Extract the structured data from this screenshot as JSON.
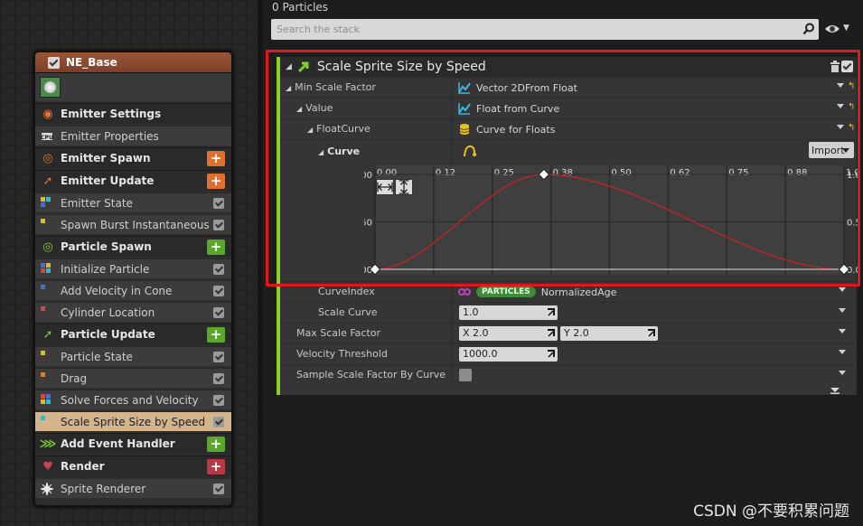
{
  "node": {
    "title": "NE_Base",
    "header_color": "#8c4a30",
    "items": [
      {
        "kind": "group",
        "label": "Emitter Settings",
        "icon": "emitter-settings-icon",
        "icon_color": "#e6703a",
        "plus": false
      },
      {
        "kind": "sub",
        "label": "Emitter Properties",
        "icon": "cpu-icon"
      },
      {
        "kind": "group",
        "label": "Emitter Spawn",
        "icon": "emitter-spawn-icon",
        "icon_color": "#e67030",
        "plus": true,
        "plus_color": "#e07030"
      },
      {
        "kind": "group",
        "label": "Emitter Update",
        "icon": "emitter-update-icon",
        "icon_color": "#e67030",
        "plus": true,
        "plus_color": "#e07030"
      },
      {
        "kind": "sub",
        "label": "Emitter State",
        "icon": "module-dots-icon",
        "dots": [
          "#d8c020",
          "#20c0d0",
          "#4a6ae0"
        ]
      },
      {
        "kind": "sub",
        "label": "Spawn Burst Instantaneous",
        "icon": "module-dots-icon",
        "dots": [
          "#d8c020"
        ]
      },
      {
        "kind": "group",
        "label": "Particle Spawn",
        "icon": "particle-spawn-icon",
        "icon_color": "#7ccf2e",
        "plus": true,
        "plus_color": "#5aa82a"
      },
      {
        "kind": "sub",
        "label": "Initialize Particle",
        "icon": "module-dots-icon",
        "dots": [
          "#4a6ae0",
          "#d8c020",
          "#e04040",
          "#20c0d0"
        ]
      },
      {
        "kind": "sub",
        "label": "Add Velocity in Cone",
        "icon": "module-dots-icon",
        "dots": [
          "#4a6ae0"
        ]
      },
      {
        "kind": "sub",
        "label": "Cylinder Location",
        "icon": "module-dots-icon",
        "dots": [
          "#e04040"
        ]
      },
      {
        "kind": "group",
        "label": "Particle Update",
        "icon": "particle-update-icon",
        "icon_color": "#7ccf2e",
        "plus": true,
        "plus_color": "#5aa82a"
      },
      {
        "kind": "sub",
        "label": "Particle State",
        "icon": "module-dots-icon",
        "dots": [
          "#d8c020"
        ]
      },
      {
        "kind": "sub",
        "label": "Drag",
        "icon": "module-dots-icon",
        "dots": [
          "#e08020"
        ]
      },
      {
        "kind": "sub",
        "label": "Solve Forces and Velocity",
        "icon": "module-dots-icon",
        "dots": [
          "#e04040",
          "#4a6ae0",
          "#d8c020",
          "#20c0d0"
        ]
      },
      {
        "kind": "sub",
        "label": "Scale Sprite Size by Speed",
        "icon": "module-dots-icon",
        "dots": [
          "#20c0d0"
        ],
        "selected": true
      },
      {
        "kind": "group",
        "label": "Add Event Handler",
        "icon": "event-handler-icon",
        "icon_color": "#7ccf2e",
        "plus": true,
        "plus_color": "#5aa82a"
      },
      {
        "kind": "group",
        "label": "Render",
        "icon": "render-icon",
        "icon_color": "#d04050",
        "plus": true,
        "plus_color": "#b83a48"
      },
      {
        "kind": "sub",
        "label": "Sprite Renderer",
        "icon": "sprite-renderer-icon"
      }
    ]
  },
  "stack": {
    "particle_count": "0 Particles",
    "search_placeholder": "Search the stack"
  },
  "module": {
    "title": "Scale Sprite Size by Speed",
    "accent_color": "#8bd12a",
    "rows": {
      "min_scale_factor": {
        "label": "Min Scale Factor",
        "value": "Vector 2DFrom Float"
      },
      "value": {
        "label": "Value",
        "value": "Float from Curve"
      },
      "float_curve": {
        "label": "FloatCurve",
        "value": "Curve for Floats"
      },
      "curve": {
        "label": "Curve",
        "button": "Import"
      },
      "curve_index": {
        "label": "CurveIndex",
        "pill": "PARTICLES",
        "value": "NormalizedAge"
      },
      "scale_curve": {
        "label": "Scale Curve",
        "value": "1.0"
      },
      "max_scale_factor": {
        "label": "Max Scale Factor",
        "x": "X 2.0",
        "y": "Y 2.0"
      },
      "velocity_threshold": {
        "label": "Velocity Threshold",
        "value": "1000.0"
      },
      "sample_scale": {
        "label": "Sample Scale Factor By Curve"
      }
    }
  },
  "chart_data": {
    "type": "line",
    "x_ticks": [
      "0.00",
      "0.12",
      "0.25",
      "0.38",
      "0.50",
      "0.62",
      "0.75",
      "0.88",
      "1.00"
    ],
    "y_ticks_left": [
      "1.00",
      "0.50",
      "0.00"
    ],
    "y_ticks_right": [
      "1.00",
      "0.50",
      "0.00"
    ],
    "xlim": [
      0,
      1
    ],
    "ylim": [
      0,
      1
    ],
    "grid": true,
    "series": [
      {
        "x": [
          0,
          0.36,
          1
        ],
        "y": [
          0,
          1,
          0
        ],
        "color": "#d02020"
      }
    ],
    "keys": [
      {
        "x": 0,
        "y": 0
      },
      {
        "x": 0.36,
        "y": 1
      },
      {
        "x": 1,
        "y": 0
      }
    ]
  },
  "watermark": "CSDN @不要积累问题"
}
